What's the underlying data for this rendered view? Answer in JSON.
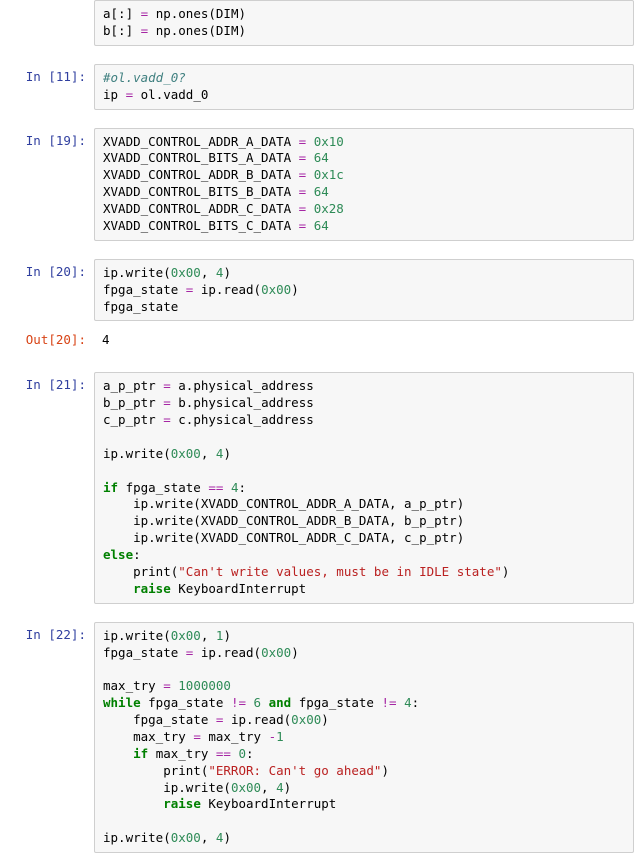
{
  "cells": [
    {
      "kind": "code_no_prompt",
      "prompt": "",
      "tokens": [
        [
          "a[:] ",
          "p"
        ],
        [
          "= ",
          "op"
        ],
        [
          "np.ones(DIM)\n",
          "p"
        ],
        [
          "b[:] ",
          "p"
        ],
        [
          "= ",
          "op"
        ],
        [
          "np.ones(DIM)",
          "p"
        ]
      ]
    },
    {
      "kind": "spacer"
    },
    {
      "kind": "code",
      "prompt": "In [11]:",
      "tokens": [
        [
          "#ol.vadd_0?\n",
          "cm"
        ],
        [
          "ip ",
          "p"
        ],
        [
          "= ",
          "op"
        ],
        [
          "ol.vadd_0",
          "p"
        ]
      ]
    },
    {
      "kind": "spacer"
    },
    {
      "kind": "code",
      "prompt": "In [19]:",
      "tokens": [
        [
          "XVADD_CONTROL_ADDR_A_DATA ",
          "p"
        ],
        [
          "= ",
          "op"
        ],
        [
          "0x10",
          "num"
        ],
        [
          "\n",
          "p"
        ],
        [
          "XVADD_CONTROL_BITS_A_DATA ",
          "p"
        ],
        [
          "= ",
          "op"
        ],
        [
          "64",
          "num"
        ],
        [
          "\n",
          "p"
        ],
        [
          "XVADD_CONTROL_ADDR_B_DATA ",
          "p"
        ],
        [
          "= ",
          "op"
        ],
        [
          "0x1c",
          "num"
        ],
        [
          "\n",
          "p"
        ],
        [
          "XVADD_CONTROL_BITS_B_DATA ",
          "p"
        ],
        [
          "= ",
          "op"
        ],
        [
          "64",
          "num"
        ],
        [
          "\n",
          "p"
        ],
        [
          "XVADD_CONTROL_ADDR_C_DATA ",
          "p"
        ],
        [
          "= ",
          "op"
        ],
        [
          "0x28",
          "num"
        ],
        [
          "\n",
          "p"
        ],
        [
          "XVADD_CONTROL_BITS_C_DATA ",
          "p"
        ],
        [
          "= ",
          "op"
        ],
        [
          "64",
          "num"
        ]
      ]
    },
    {
      "kind": "spacer"
    },
    {
      "kind": "code",
      "prompt": "In [20]:",
      "tokens": [
        [
          "ip.write(",
          "p"
        ],
        [
          "0x00",
          "num"
        ],
        [
          ", ",
          "p"
        ],
        [
          "4",
          "num"
        ],
        [
          ")\n",
          "p"
        ],
        [
          "fpga_state ",
          "p"
        ],
        [
          "= ",
          "op"
        ],
        [
          "ip.read(",
          "p"
        ],
        [
          "0x00",
          "num"
        ],
        [
          ")\n",
          "p"
        ],
        [
          "fpga_state",
          "p"
        ]
      ]
    },
    {
      "kind": "out",
      "prompt": "Out[20]:",
      "tokens": [
        [
          "4",
          "p"
        ]
      ]
    },
    {
      "kind": "spacer"
    },
    {
      "kind": "code",
      "prompt": "In [21]:",
      "tokens": [
        [
          "a_p_ptr ",
          "p"
        ],
        [
          "= ",
          "op"
        ],
        [
          "a.physical_address\n",
          "p"
        ],
        [
          "b_p_ptr ",
          "p"
        ],
        [
          "= ",
          "op"
        ],
        [
          "b.physical_address\n",
          "p"
        ],
        [
          "c_p_ptr ",
          "p"
        ],
        [
          "= ",
          "op"
        ],
        [
          "c.physical_address\n",
          "p"
        ],
        [
          "\n",
          "p"
        ],
        [
          "ip.write(",
          "p"
        ],
        [
          "0x00",
          "num"
        ],
        [
          ", ",
          "p"
        ],
        [
          "4",
          "num"
        ],
        [
          ")\n",
          "p"
        ],
        [
          "\n",
          "p"
        ],
        [
          "if ",
          "kw"
        ],
        [
          "fpga_state ",
          "p"
        ],
        [
          "== ",
          "op"
        ],
        [
          "4",
          "num"
        ],
        [
          ":\n",
          "p"
        ],
        [
          "    ip.write(XVADD_CONTROL_ADDR_A_DATA, a_p_ptr)\n",
          "p"
        ],
        [
          "    ip.write(XVADD_CONTROL_ADDR_B_DATA, b_p_ptr)\n",
          "p"
        ],
        [
          "    ip.write(XVADD_CONTROL_ADDR_C_DATA, c_p_ptr)\n",
          "p"
        ],
        [
          "else",
          "kw"
        ],
        [
          ":\n",
          "p"
        ],
        [
          "    print(",
          "p"
        ],
        [
          "\"Can't write values, must be in IDLE state\"",
          "str"
        ],
        [
          ")\n",
          "p"
        ],
        [
          "    ",
          "p"
        ],
        [
          "raise ",
          "kw"
        ],
        [
          "KeyboardInterrupt",
          "p"
        ]
      ]
    },
    {
      "kind": "spacer"
    },
    {
      "kind": "code",
      "prompt": "In [22]:",
      "tokens": [
        [
          "ip.write(",
          "p"
        ],
        [
          "0x00",
          "num"
        ],
        [
          ", ",
          "p"
        ],
        [
          "1",
          "num"
        ],
        [
          ")\n",
          "p"
        ],
        [
          "fpga_state ",
          "p"
        ],
        [
          "= ",
          "op"
        ],
        [
          "ip.read(",
          "p"
        ],
        [
          "0x00",
          "num"
        ],
        [
          ")\n",
          "p"
        ],
        [
          "\n",
          "p"
        ],
        [
          "max_try ",
          "p"
        ],
        [
          "= ",
          "op"
        ],
        [
          "1000000",
          "num"
        ],
        [
          "\n",
          "p"
        ],
        [
          "while ",
          "kw"
        ],
        [
          "fpga_state ",
          "p"
        ],
        [
          "!= ",
          "op"
        ],
        [
          "6",
          "num"
        ],
        [
          " ",
          "p"
        ],
        [
          "and ",
          "kw"
        ],
        [
          "fpga_state ",
          "p"
        ],
        [
          "!= ",
          "op"
        ],
        [
          "4",
          "num"
        ],
        [
          ":\n",
          "p"
        ],
        [
          "    fpga_state ",
          "p"
        ],
        [
          "= ",
          "op"
        ],
        [
          "ip.read(",
          "p"
        ],
        [
          "0x00",
          "num"
        ],
        [
          ")\n",
          "p"
        ],
        [
          "    max_try ",
          "p"
        ],
        [
          "= ",
          "op"
        ],
        [
          "max_try ",
          "p"
        ],
        [
          "-",
          "op"
        ],
        [
          "1",
          "num"
        ],
        [
          "\n",
          "p"
        ],
        [
          "    ",
          "p"
        ],
        [
          "if ",
          "kw"
        ],
        [
          "max_try ",
          "p"
        ],
        [
          "== ",
          "op"
        ],
        [
          "0",
          "num"
        ],
        [
          ":\n",
          "p"
        ],
        [
          "        print(",
          "p"
        ],
        [
          "\"ERROR: Can't go ahead\"",
          "str"
        ],
        [
          ")\n",
          "p"
        ],
        [
          "        ip.write(",
          "p"
        ],
        [
          "0x00",
          "num"
        ],
        [
          ", ",
          "p"
        ],
        [
          "4",
          "num"
        ],
        [
          ")\n",
          "p"
        ],
        [
          "        ",
          "p"
        ],
        [
          "raise ",
          "kw"
        ],
        [
          "KeyboardInterrupt\n",
          "p"
        ],
        [
          "\n",
          "p"
        ],
        [
          "ip.write(",
          "p"
        ],
        [
          "0x00",
          "num"
        ],
        [
          ", ",
          "p"
        ],
        [
          "4",
          "num"
        ],
        [
          ")",
          "p"
        ]
      ]
    }
  ]
}
